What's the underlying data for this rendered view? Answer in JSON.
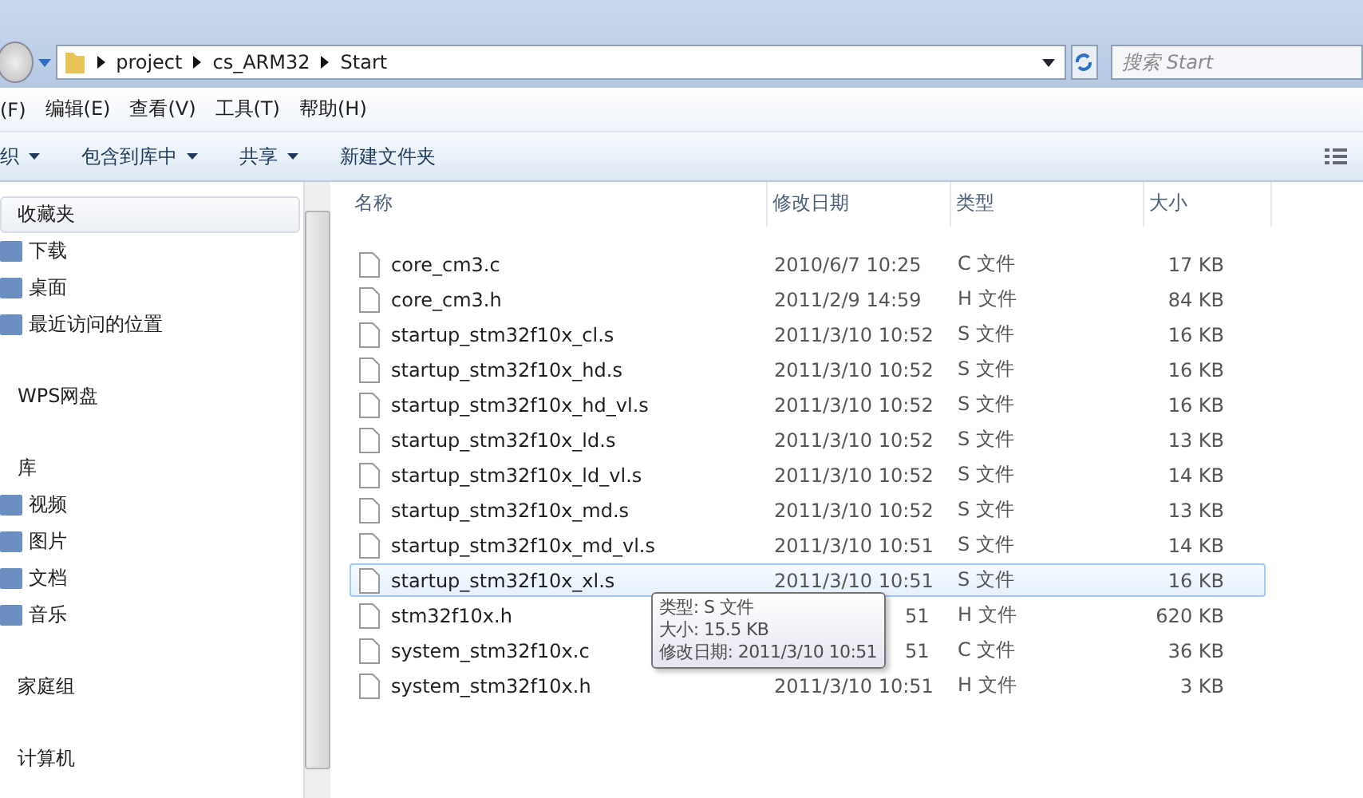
{
  "address_bar": {
    "crumbs": [
      "project",
      "cs_ARM32",
      "Start"
    ]
  },
  "search": {
    "placeholder": "搜索 Start"
  },
  "menu": [
    "(F)",
    "编辑(E)",
    "查看(V)",
    "工具(T)",
    "帮助(H)"
  ],
  "toolbar": [
    {
      "label": "织",
      "dropdown": true
    },
    {
      "label": "包含到库中",
      "dropdown": true
    },
    {
      "label": "共享",
      "dropdown": true
    },
    {
      "label": "新建文件夹",
      "dropdown": false
    }
  ],
  "sidebar": {
    "groups": [
      {
        "label": "收藏夹",
        "selected": true,
        "children": [
          {
            "label": "下载"
          },
          {
            "label": "桌面"
          },
          {
            "label": "最近访问的位置"
          }
        ]
      },
      {
        "label": "WPS网盘",
        "selected": false
      },
      {
        "label": "库",
        "selected": false,
        "children": [
          {
            "label": "视频"
          },
          {
            "label": "图片"
          },
          {
            "label": "文档"
          },
          {
            "label": "音乐"
          }
        ]
      },
      {
        "label": "家庭组",
        "selected": false
      },
      {
        "label": "计算机",
        "selected": false
      }
    ]
  },
  "table": {
    "columns": [
      "名称",
      "修改日期",
      "类型",
      "大小"
    ],
    "rows": [
      {
        "name": "core_cm3.c",
        "date": "2010/6/7 10:25",
        "type": "C 文件",
        "size": "17 KB",
        "selected": false,
        "covered": false
      },
      {
        "name": "core_cm3.h",
        "date": "2011/2/9 14:59",
        "type": "H 文件",
        "size": "84 KB",
        "selected": false,
        "covered": false
      },
      {
        "name": "startup_stm32f10x_cl.s",
        "date": "2011/3/10 10:52",
        "type": "S 文件",
        "size": "16 KB",
        "selected": false,
        "covered": false
      },
      {
        "name": "startup_stm32f10x_hd.s",
        "date": "2011/3/10 10:52",
        "type": "S 文件",
        "size": "16 KB",
        "selected": false,
        "covered": false
      },
      {
        "name": "startup_stm32f10x_hd_vl.s",
        "date": "2011/3/10 10:52",
        "type": "S 文件",
        "size": "16 KB",
        "selected": false,
        "covered": false
      },
      {
        "name": "startup_stm32f10x_ld.s",
        "date": "2011/3/10 10:52",
        "type": "S 文件",
        "size": "13 KB",
        "selected": false,
        "covered": false
      },
      {
        "name": "startup_stm32f10x_ld_vl.s",
        "date": "2011/3/10 10:52",
        "type": "S 文件",
        "size": "14 KB",
        "selected": false,
        "covered": false
      },
      {
        "name": "startup_stm32f10x_md.s",
        "date": "2011/3/10 10:52",
        "type": "S 文件",
        "size": "13 KB",
        "selected": false,
        "covered": false
      },
      {
        "name": "startup_stm32f10x_md_vl.s",
        "date": "2011/3/10 10:51",
        "type": "S 文件",
        "size": "14 KB",
        "selected": false,
        "covered": false
      },
      {
        "name": "startup_stm32f10x_xl.s",
        "date": "2011/3/10 10:51",
        "type": "S 文件",
        "size": "16 KB",
        "selected": true,
        "covered": false
      },
      {
        "name": "stm32f10x.h",
        "date": "51",
        "type": "H 文件",
        "size": "620 KB",
        "selected": false,
        "covered": true
      },
      {
        "name": "system_stm32f10x.c",
        "date": "51",
        "type": "C 文件",
        "size": "36 KB",
        "selected": false,
        "covered": true
      },
      {
        "name": "system_stm32f10x.h",
        "date": "2011/3/10 10:51",
        "type": "H 文件",
        "size": "3 KB",
        "selected": false,
        "covered": false
      }
    ]
  },
  "tooltip": [
    "类型: S 文件",
    "大小: 15.5 KB",
    "修改日期: 2011/3/10 10:51"
  ]
}
